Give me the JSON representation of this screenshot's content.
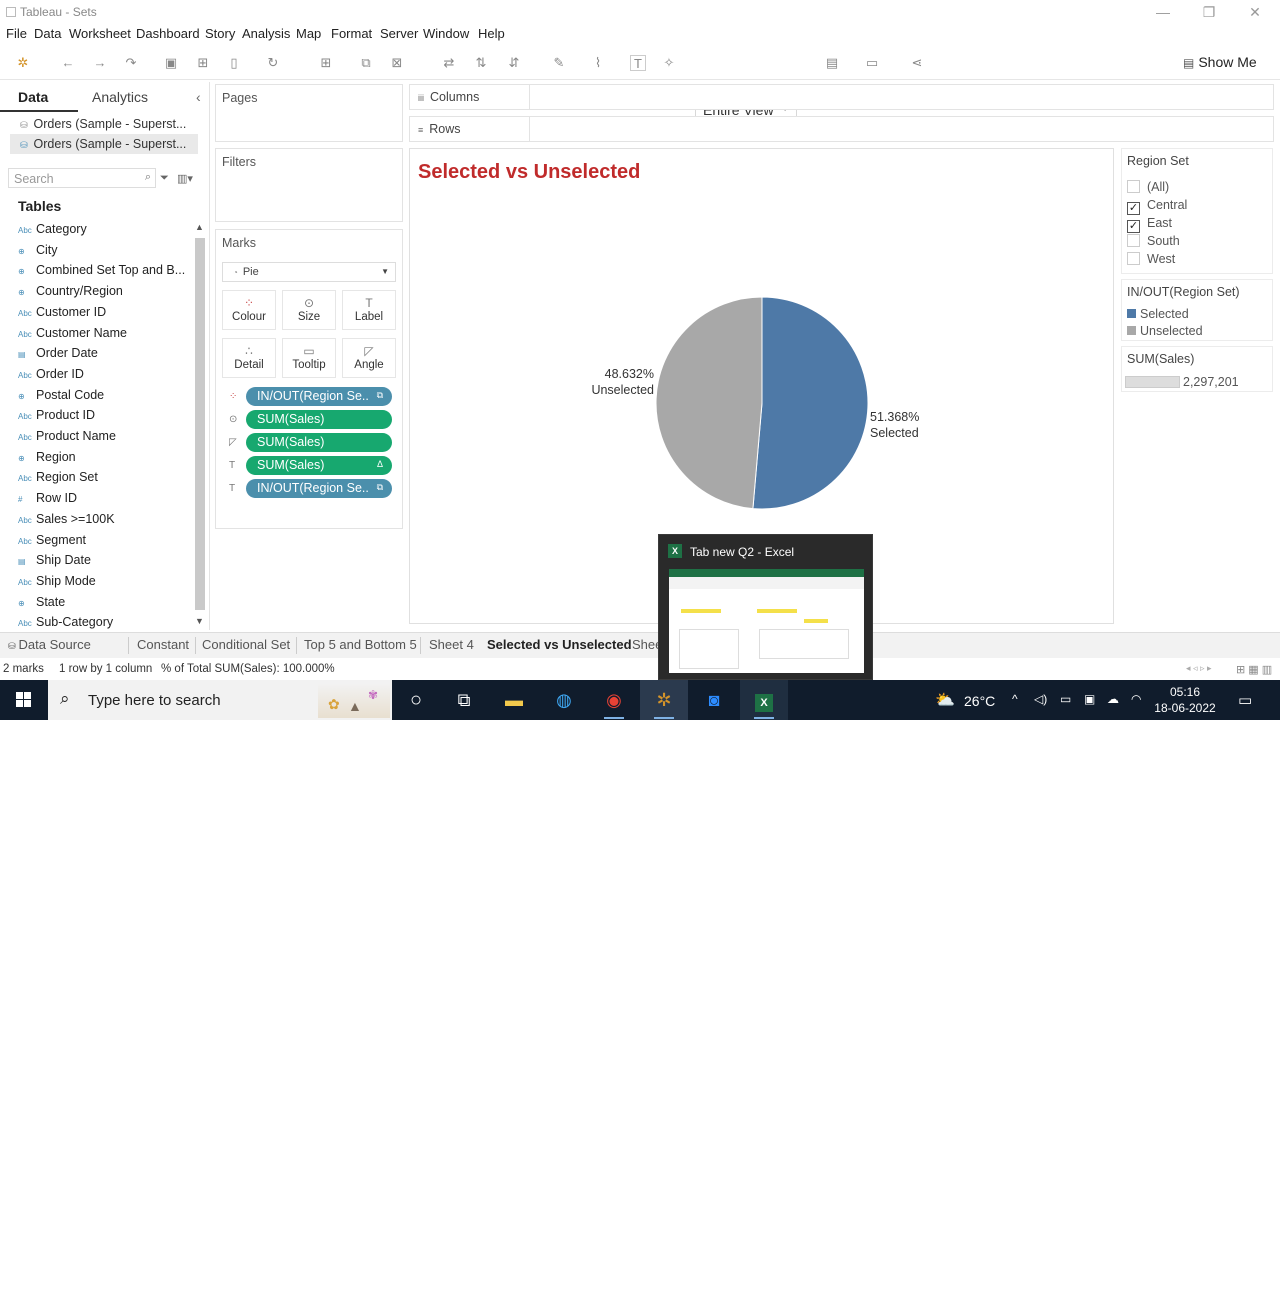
{
  "window": {
    "title": "Tableau - Sets",
    "min": "—",
    "restore": "❐",
    "close": "✕"
  },
  "menu": [
    "File",
    "Data",
    "Worksheet",
    "Dashboard",
    "Story",
    "Analysis",
    "Map",
    "Format",
    "Server",
    "Window",
    "Help"
  ],
  "toolbar": {
    "fit_value": "Entire View",
    "show_me": "Show Me"
  },
  "data_pane": {
    "tab_data": "Data",
    "tab_analytics": "Analytics",
    "collapse": "‹",
    "sources": [
      "Orders (Sample - Superst...",
      "Orders (Sample - Superst..."
    ],
    "search_placeholder": "Search",
    "tables_heading": "Tables",
    "fields": [
      {
        "icon": "Abc",
        "name": "Category"
      },
      {
        "icon": "⊕",
        "name": "City"
      },
      {
        "icon": "⊕",
        "name": "Combined Set Top and B..."
      },
      {
        "icon": "⊕",
        "name": "Country/Region"
      },
      {
        "icon": "Abc",
        "name": "Customer ID"
      },
      {
        "icon": "Abc",
        "name": "Customer Name"
      },
      {
        "icon": "▤",
        "name": "Order Date"
      },
      {
        "icon": "Abc",
        "name": "Order ID"
      },
      {
        "icon": "⊕",
        "name": "Postal Code"
      },
      {
        "icon": "Abc",
        "name": "Product ID"
      },
      {
        "icon": "Abc",
        "name": "Product Name"
      },
      {
        "icon": "⊕",
        "name": "Region"
      },
      {
        "icon": "Abc",
        "name": "Region Set"
      },
      {
        "icon": "#",
        "name": "Row ID"
      },
      {
        "icon": "Abc",
        "name": "Sales >=100K"
      },
      {
        "icon": "Abc",
        "name": "Segment"
      },
      {
        "icon": "▤",
        "name": "Ship Date"
      },
      {
        "icon": "Abc",
        "name": "Ship Mode"
      },
      {
        "icon": "⊕",
        "name": "State"
      },
      {
        "icon": "Abc",
        "name": "Sub-Category"
      }
    ]
  },
  "cards": {
    "pages": "Pages",
    "filters": "Filters",
    "marks": "Marks",
    "columns": "Columns",
    "rows": "Rows"
  },
  "marks": {
    "mark_type": "Pie",
    "buttons": [
      "Colour",
      "Size",
      "Label",
      "Detail",
      "Tooltip",
      "Angle"
    ],
    "pills": [
      {
        "label": "IN/OUT(Region Se..",
        "kind": "blue",
        "icon": "⧉"
      },
      {
        "label": "SUM(Sales)",
        "kind": "green",
        "icon": ""
      },
      {
        "label": "SUM(Sales)",
        "kind": "green",
        "icon": ""
      },
      {
        "label": "SUM(Sales)",
        "kind": "green",
        "icon": "Δ"
      },
      {
        "label": "IN/OUT(Region Se..",
        "kind": "blue",
        "icon": "⧉"
      }
    ]
  },
  "view": {
    "title": "Selected vs Unselected",
    "unselected_pct": "48.632%",
    "unselected_name": "Unselected",
    "selected_pct": "51.368%",
    "selected_name": "Selected"
  },
  "chart_data": {
    "type": "pie",
    "title": "Selected vs Unselected",
    "categories": [
      "Selected",
      "Unselected"
    ],
    "values": [
      51.368,
      48.632
    ],
    "colors": [
      "#4e79a7",
      "#a8a8a8"
    ]
  },
  "legends": {
    "region_set_title": "Region Set",
    "region_set_items": [
      {
        "label": "(All)",
        "checked": false
      },
      {
        "label": "Central",
        "checked": true
      },
      {
        "label": "East",
        "checked": true
      },
      {
        "label": "South",
        "checked": false
      },
      {
        "label": "West",
        "checked": false
      }
    ],
    "inout_title": "IN/OUT(Region Set)",
    "inout_items": [
      {
        "label": "Selected",
        "color": "#4e79a7"
      },
      {
        "label": "Unselected",
        "color": "#a8a8a8"
      }
    ],
    "size_title": "SUM(Sales)",
    "size_value": "2,297,201"
  },
  "sheet_tabs": [
    {
      "label": "Data Source",
      "active": false
    },
    {
      "label": "Constant",
      "active": false
    },
    {
      "label": "Conditional Set",
      "active": false
    },
    {
      "label": "Top 5 and Bottom 5",
      "active": false
    },
    {
      "label": "Sheet 4",
      "active": false
    },
    {
      "label": "Selected vs Unselected",
      "active": true
    },
    {
      "label": "Shee",
      "active": false
    }
  ],
  "status": {
    "marks": "2 marks",
    "dims": "1 row by 1 column",
    "pct": "% of Total SUM(Sales): 100.000%"
  },
  "preview": {
    "title": "Tab new Q2 - Excel"
  },
  "taskbar": {
    "search": "Type here to search",
    "temp": "26°C",
    "time": "05:16",
    "date": "18-06-2022"
  }
}
